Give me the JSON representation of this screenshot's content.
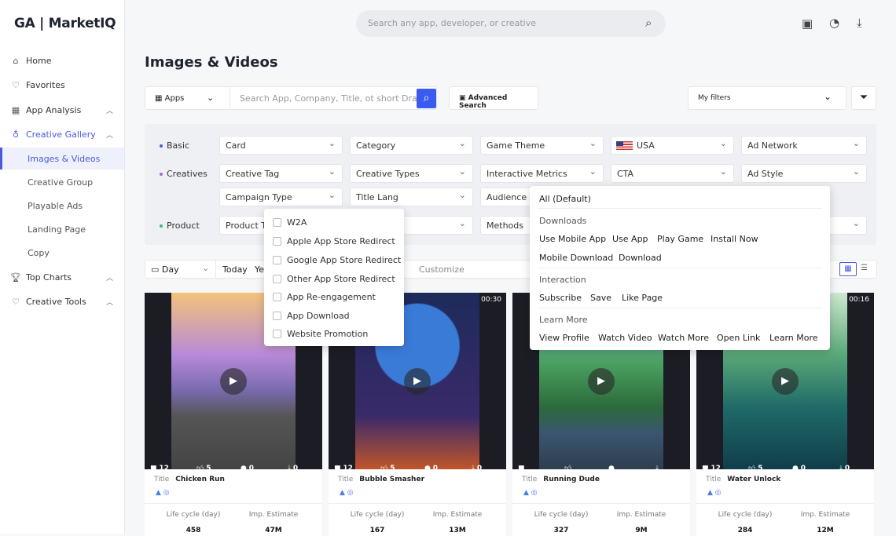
{
  "brand": "GA | MarketIQ",
  "sidebar": {
    "items": [
      {
        "label": "Home",
        "icon": "home-icon"
      },
      {
        "label": "Favorites",
        "icon": "heart-icon"
      },
      {
        "label": "App Analysis",
        "icon": "grid-icon"
      },
      {
        "label": "Creative Gallery",
        "icon": "bulb-icon"
      },
      {
        "label": "Images & Videos"
      },
      {
        "label": "Creative Group"
      },
      {
        "label": "Playable Ads"
      },
      {
        "label": "Landing Page"
      },
      {
        "label": "Copy"
      },
      {
        "label": "Top Charts",
        "icon": "trophy-icon"
      },
      {
        "label": "Creative Tools",
        "icon": "heart-icon"
      }
    ]
  },
  "header": {
    "search_placeholder": "Search any app, developer, or creative"
  },
  "page_title": "Images & Videos",
  "toolbar": {
    "scope": "Apps",
    "search_placeholder": "Search App, Company, Title, ot short Drama",
    "advanced": "Advanced Search",
    "my_filters": "My filters"
  },
  "filters": {
    "rows": [
      "Basic",
      "Creatives",
      "Product"
    ],
    "basic": [
      "Card",
      "Category",
      "Game Theme",
      "USA",
      "Ad Network"
    ],
    "creatives": [
      "Creative Tag",
      "Creative Types",
      "Interactive Metrics",
      "CTA",
      "Ad Style"
    ],
    "creatives2": [
      "Campaign Type",
      "Title Lang",
      "Audience A"
    ],
    "product": [
      "Product Ty",
      "",
      "Methods"
    ]
  },
  "campaign_dropdown": [
    "W2A",
    "Apple App Store Redirect",
    "Google App Store Redirect",
    "Other App Store Redirect",
    "App Re-engagement",
    "App Download",
    "Website Promotion"
  ],
  "cta_dropdown": {
    "default": "All (Default)",
    "groups": [
      {
        "name": "Downloads",
        "items": [
          "Use Mobile App",
          "Use App",
          "Play Game",
          "Install Now",
          "Mobile Download",
          "Download"
        ]
      },
      {
        "name": "Interaction",
        "items": [
          "Subscribe",
          "Save",
          "Like Page"
        ]
      },
      {
        "name": "Learn More",
        "items": [
          "View Profile",
          "Watch Video",
          "Watch More",
          "Open Link",
          "Learn More"
        ]
      }
    ]
  },
  "date": {
    "unit": "Day",
    "today": "Today",
    "ye": "Ye",
    "customize": "Customize"
  },
  "cards": [
    {
      "title_label": "Title",
      "title": "Chicken Run",
      "duration": "",
      "videos": "12",
      "likes": "5",
      "comments": "0",
      "downloads": "0",
      "lifecycle_label": "Life cycle (day)",
      "lifecycle": "458",
      "imp_label": "Imp. Estimate",
      "imp": "47M"
    },
    {
      "title_label": "Title",
      "title": "Bubble Smasher",
      "duration": "00:30",
      "videos": "12",
      "likes": "5",
      "comments": "0",
      "downloads": "0",
      "lifecycle_label": "Life cycle (day)",
      "lifecycle": "167",
      "imp_label": "Imp. Estimate",
      "imp": "13M"
    },
    {
      "title_label": "Title",
      "title": "Running Dude",
      "duration": "",
      "videos": "",
      "likes": "",
      "comments": "",
      "downloads": "",
      "lifecycle_label": "Life cycle (day)",
      "lifecycle": "327",
      "imp_label": "Imp. Estimate",
      "imp": "9M"
    },
    {
      "title_label": "Title",
      "title": "Water Unlock",
      "duration": "00:16",
      "videos": "12",
      "likes": "5",
      "comments": "0",
      "downloads": "0",
      "lifecycle_label": "Life cycle (day)",
      "lifecycle": "284",
      "imp_label": "Imp. Estimate",
      "imp": "12M"
    }
  ],
  "colors": {
    "accent": "#4a5bd8",
    "search_button": "#3b5bf0"
  }
}
